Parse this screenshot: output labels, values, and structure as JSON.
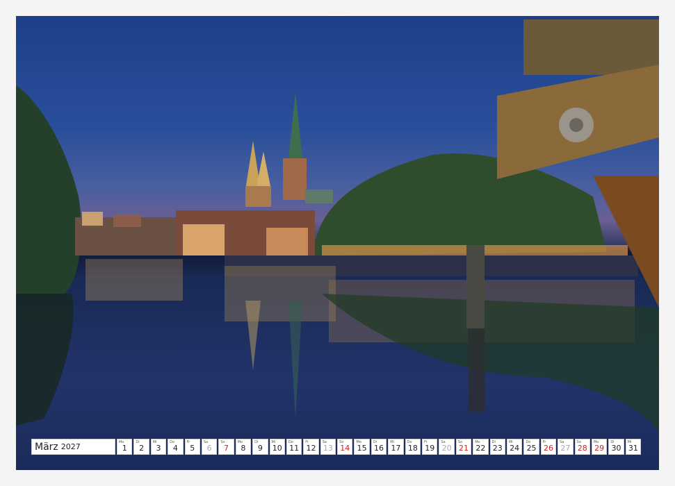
{
  "calendar": {
    "month": "März",
    "year": "2027",
    "days": [
      {
        "wd": "Mo",
        "n": "1",
        "t": ""
      },
      {
        "wd": "Di",
        "n": "2",
        "t": ""
      },
      {
        "wd": "Mi",
        "n": "3",
        "t": ""
      },
      {
        "wd": "Do",
        "n": "4",
        "t": ""
      },
      {
        "wd": "Fr",
        "n": "5",
        "t": ""
      },
      {
        "wd": "Sa",
        "n": "6",
        "t": "sat"
      },
      {
        "wd": "So",
        "n": "7",
        "t": "sun"
      },
      {
        "wd": "Mo",
        "n": "8",
        "t": ""
      },
      {
        "wd": "Di",
        "n": "9",
        "t": ""
      },
      {
        "wd": "Mi",
        "n": "10",
        "t": ""
      },
      {
        "wd": "Do",
        "n": "11",
        "t": ""
      },
      {
        "wd": "Fr",
        "n": "12",
        "t": ""
      },
      {
        "wd": "Sa",
        "n": "13",
        "t": "sat"
      },
      {
        "wd": "So",
        "n": "14",
        "t": "sun"
      },
      {
        "wd": "Mo",
        "n": "15",
        "t": ""
      },
      {
        "wd": "Di",
        "n": "16",
        "t": ""
      },
      {
        "wd": "Mi",
        "n": "17",
        "t": ""
      },
      {
        "wd": "Do",
        "n": "18",
        "t": ""
      },
      {
        "wd": "Fr",
        "n": "19",
        "t": ""
      },
      {
        "wd": "Sa",
        "n": "20",
        "t": "sat"
      },
      {
        "wd": "So",
        "n": "21",
        "t": "sun"
      },
      {
        "wd": "Mo",
        "n": "22",
        "t": ""
      },
      {
        "wd": "Di",
        "n": "23",
        "t": ""
      },
      {
        "wd": "Mi",
        "n": "24",
        "t": ""
      },
      {
        "wd": "Do",
        "n": "25",
        "t": ""
      },
      {
        "wd": "Fr",
        "n": "26",
        "t": "sun"
      },
      {
        "wd": "Sa",
        "n": "27",
        "t": "sat"
      },
      {
        "wd": "So",
        "n": "28",
        "t": "sun"
      },
      {
        "wd": "Mo",
        "n": "29",
        "t": "sun"
      },
      {
        "wd": "Di",
        "n": "30",
        "t": ""
      },
      {
        "wd": "Mi",
        "n": "31",
        "t": ""
      }
    ]
  },
  "photo": {
    "subject": "cathedral-spires-riverfront-night-reflection",
    "colors": {
      "sky_top": "#1d3f8a",
      "sky_horizon": "#6a5f93",
      "water": "#1a2a55",
      "lights": "#f2c14e",
      "trees": "#2e4a2a",
      "wood": "#8a6a3a"
    }
  }
}
